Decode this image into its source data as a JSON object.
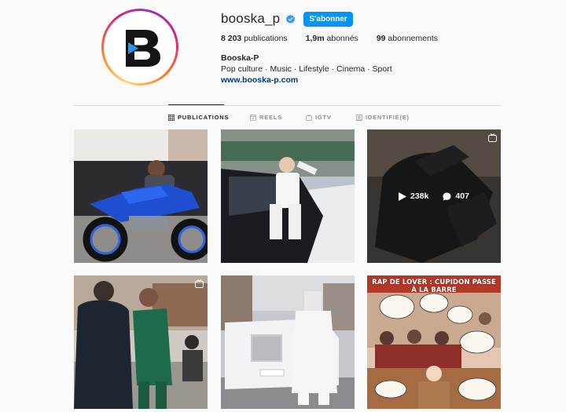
{
  "profile": {
    "username": "booska_p",
    "follow_label": "S'abonner",
    "logo_letter": "B",
    "stats": {
      "posts_count": "8 203",
      "posts_label": "publications",
      "followers_count": "1,9m",
      "followers_label": "abonnés",
      "following_count": "99",
      "following_label": "abonnements"
    },
    "bio": {
      "name": "Booska-P",
      "description": "Pop culture · Music · Lifestyle · Cinema · Sport",
      "link": "www.booska-p.com"
    }
  },
  "tabs": [
    {
      "label": "PUBLICATIONS",
      "icon": "grid-icon",
      "active": true
    },
    {
      "label": "REELS",
      "icon": "reels-icon",
      "active": false
    },
    {
      "label": "IGTV",
      "icon": "igtv-icon",
      "active": false
    },
    {
      "label": "IDENTIFIÉ(E)",
      "icon": "tagged-icon",
      "active": false
    }
  ],
  "posts": [
    {
      "subject": "man on blue motorcycle",
      "type_icon": null
    },
    {
      "subject": "man in white by car in snow",
      "type_icon": null
    },
    {
      "subject": "gloved hands",
      "type_icon": "igtv-icon",
      "hover": {
        "views": "238k",
        "comments": "407"
      }
    },
    {
      "subject": "two men greeting",
      "type_icon": "igtv-icon"
    },
    {
      "subject": "masked man by white rolls royce",
      "type_icon": null
    },
    {
      "subject": "comic courtroom",
      "type_icon": null,
      "caption": "RAP DE LOVER : CUPIDON PASSE À LA BARRE"
    }
  ],
  "colors": {
    "accent": "#0095f6",
    "link": "#00376b",
    "muted": "#8e8e8e",
    "text": "#262626"
  }
}
